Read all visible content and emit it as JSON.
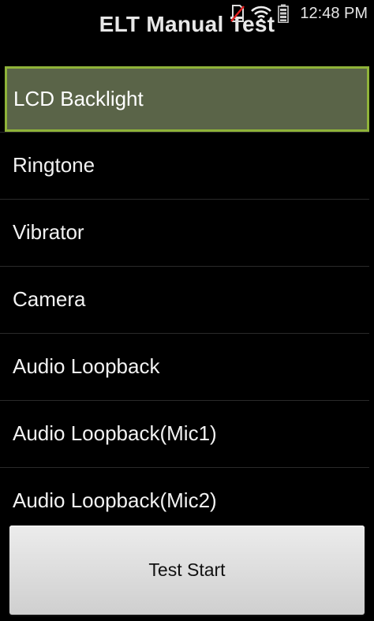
{
  "status_bar": {
    "time": "12:48 PM",
    "icons": [
      "no-sim-icon",
      "wifi-icon",
      "battery-icon"
    ]
  },
  "app": {
    "title": "ELT Manual Test"
  },
  "items": [
    {
      "label": "LCD Backlight",
      "selected": true
    },
    {
      "label": "Ringtone"
    },
    {
      "label": "Vibrator"
    },
    {
      "label": "Camera"
    },
    {
      "label": "Audio Loopback"
    },
    {
      "label": "Audio Loopback(Mic1)"
    },
    {
      "label": "Audio Loopback(Mic2)"
    }
  ],
  "footer": {
    "button_label": "Test Start"
  },
  "colors": {
    "background": "#000000",
    "selected_fill": "#5a6448",
    "selected_border": "#8fb339",
    "button_fill": "#dedede"
  }
}
